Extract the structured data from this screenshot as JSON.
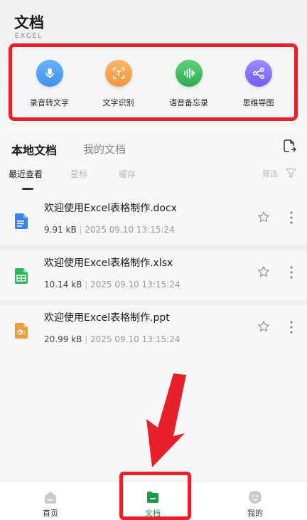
{
  "header": {
    "title": "文档",
    "subtitle": "EXCEL"
  },
  "tools": [
    {
      "label": "录音转文字",
      "icon": "microphone-icon",
      "color": "#4a9cf0"
    },
    {
      "label": "文字识别",
      "icon": "text-scan-icon",
      "color": "#f5a04c"
    },
    {
      "label": "语音备忘录",
      "icon": "audio-wave-icon",
      "color": "#34b95a"
    },
    {
      "label": "思维导图",
      "icon": "mind-map-icon",
      "color": "#7b6ef5"
    }
  ],
  "tabs": {
    "local": "本地文档",
    "mine": "我的文档"
  },
  "filters": {
    "recent": "最近查看",
    "starred": "星标",
    "cache": "缓存",
    "filter_label": "筛选"
  },
  "files": [
    {
      "name": "欢迎使用Excel表格制作.docx",
      "size": "9.91 kB",
      "sep": " | ",
      "date": "2025 09.10 13:15:24",
      "type": "docx",
      "color": "#3a86e8"
    },
    {
      "name": "欢迎使用Excel表格制作.xlsx",
      "size": "10.14 kB",
      "sep": " | ",
      "date": "2025 09.10 13:15:24",
      "type": "xlsx",
      "color": "#2fb65c"
    },
    {
      "name": "欢迎使用Excel表格制作.ppt",
      "size": "20.99 kB",
      "sep": " | ",
      "date": "2025 09.10 13:15:24",
      "type": "ppt",
      "color": "#f09a3e"
    }
  ],
  "nav": [
    {
      "label": "首页",
      "icon": "home-icon",
      "active": false
    },
    {
      "label": "文档",
      "icon": "document-icon",
      "active": true
    },
    {
      "label": "我的",
      "icon": "profile-icon",
      "active": false
    }
  ],
  "colors": {
    "highlight": "#e8202a",
    "active_green": "#1a9b4b"
  }
}
